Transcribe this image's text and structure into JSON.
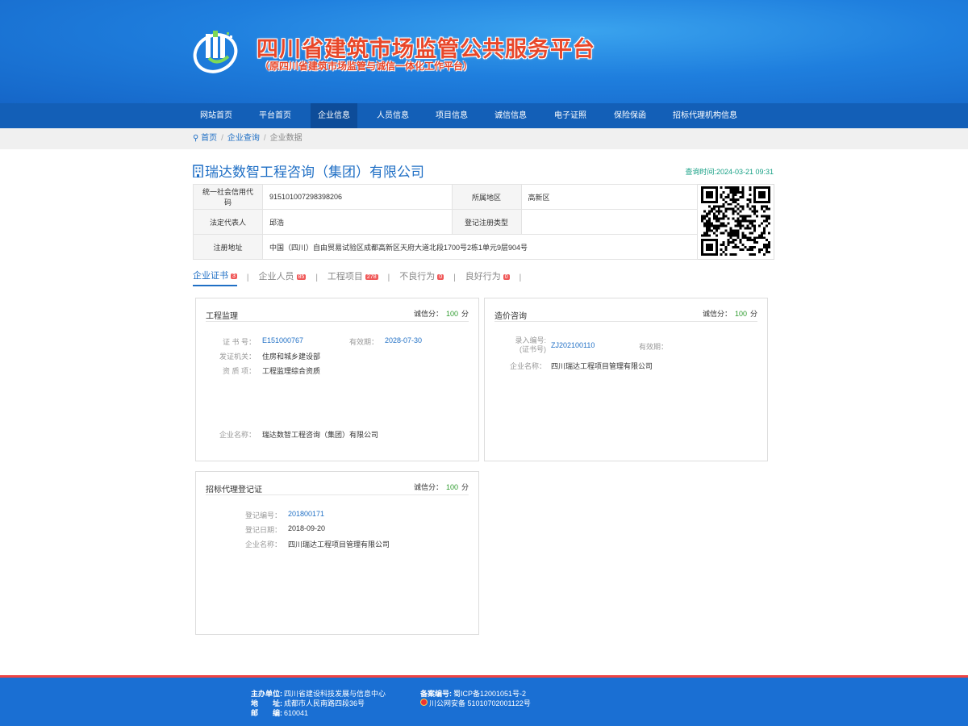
{
  "header": {
    "title": "四川省建筑市场监管公共服务平台",
    "subtitle": "（原四川省建筑市场监管与诚信一体化工作平台）"
  },
  "nav": {
    "items": [
      {
        "label": "网站首页",
        "active": false
      },
      {
        "label": "平台首页",
        "active": false
      },
      {
        "label": "企业信息",
        "active": true
      },
      {
        "label": "人员信息",
        "active": false
      },
      {
        "label": "项目信息",
        "active": false
      },
      {
        "label": "诚信信息",
        "active": false
      },
      {
        "label": "电子证照",
        "active": false
      },
      {
        "label": "保险保函",
        "active": false
      },
      {
        "label": "招标代理机构信息",
        "active": false
      }
    ]
  },
  "breadcrumb": {
    "home": "首页",
    "level2": "企业查询",
    "current": "企业数据"
  },
  "company": {
    "name": "瑞达数智工程咨询（集团）有限公司",
    "query_time": "查询时间:2024-03-21 09:31"
  },
  "info": {
    "credit_code_label": "统一社会信用代码",
    "credit_code": "915101007298398206",
    "region_label": "所属地区",
    "region": "高新区",
    "legal_rep_label": "法定代表人",
    "legal_rep": "邱浩",
    "reg_type_label": "登记注册类型",
    "reg_type": "",
    "address_label": "注册地址",
    "address": "中国（四川）自由贸易试验区成都高新区天府大道北段1700号2栋1单元9层904号"
  },
  "tabs": [
    {
      "label": "企业证书",
      "count": "3",
      "active": true
    },
    {
      "label": "企业人员",
      "count": "85",
      "active": false
    },
    {
      "label": "工程项目",
      "count": "278",
      "active": false
    },
    {
      "label": "不良行为",
      "count": "0",
      "active": false
    },
    {
      "label": "良好行为",
      "count": "0",
      "active": false
    }
  ],
  "cards": {
    "supervision": {
      "title": "工程监理",
      "score_label": "诚信分：",
      "score": "100",
      "score_unit": "分",
      "cert_no_label": "证 书 号：",
      "cert_no": "E151000767",
      "valid_label": "有效期：",
      "valid": "2028-07-30",
      "issuer_label": "发证机关：",
      "issuer": "住房和城乡建设部",
      "qual_label": "资 质 项：",
      "qual": "工程监理综合资质",
      "company_label": "企业名称：",
      "company": "瑞达数智工程咨询（集团）有限公司"
    },
    "costing": {
      "title": "造价咨询",
      "score_label": "诚信分：",
      "score": "100",
      "score_unit": "分",
      "entry_no_label": "录入编号:",
      "entry_no_label2": "(证书号)",
      "entry_no": "ZJ202100110",
      "valid_label": "有效期：",
      "valid": "",
      "company_label": "企业名称：",
      "company": "四川瑞达工程项目管理有限公司"
    },
    "bidding": {
      "title": "招标代理登记证",
      "score_label": "诚信分：",
      "score": "100",
      "score_unit": "分",
      "reg_no_label": "登记编号：",
      "reg_no": "201800171",
      "reg_date_label": "登记日期：",
      "reg_date": "2018-09-20",
      "company_label": "企业名称：",
      "company": "四川瑞达工程项目管理有限公司"
    }
  },
  "footer": {
    "host_label": "主办单位:",
    "host": "四川省建设科技发展与信息中心",
    "addr_label": "地　　址:",
    "addr": "成都市人民南路四段36号",
    "zip_label": "邮　　编:",
    "zip": "610041",
    "icp_label": "备案编号:",
    "icp": "蜀ICP备12001051号-2",
    "police": "川公网安备 51010702001122号"
  },
  "colors": {
    "header_blue": "#1f7fde",
    "nav_blue": "#135fb7",
    "nav_active": "#0d4c99",
    "link_blue": "#1f6fc5",
    "title_red": "#e8472a",
    "score_green": "#2e9b2e",
    "badge_red": "#f05a5a"
  }
}
